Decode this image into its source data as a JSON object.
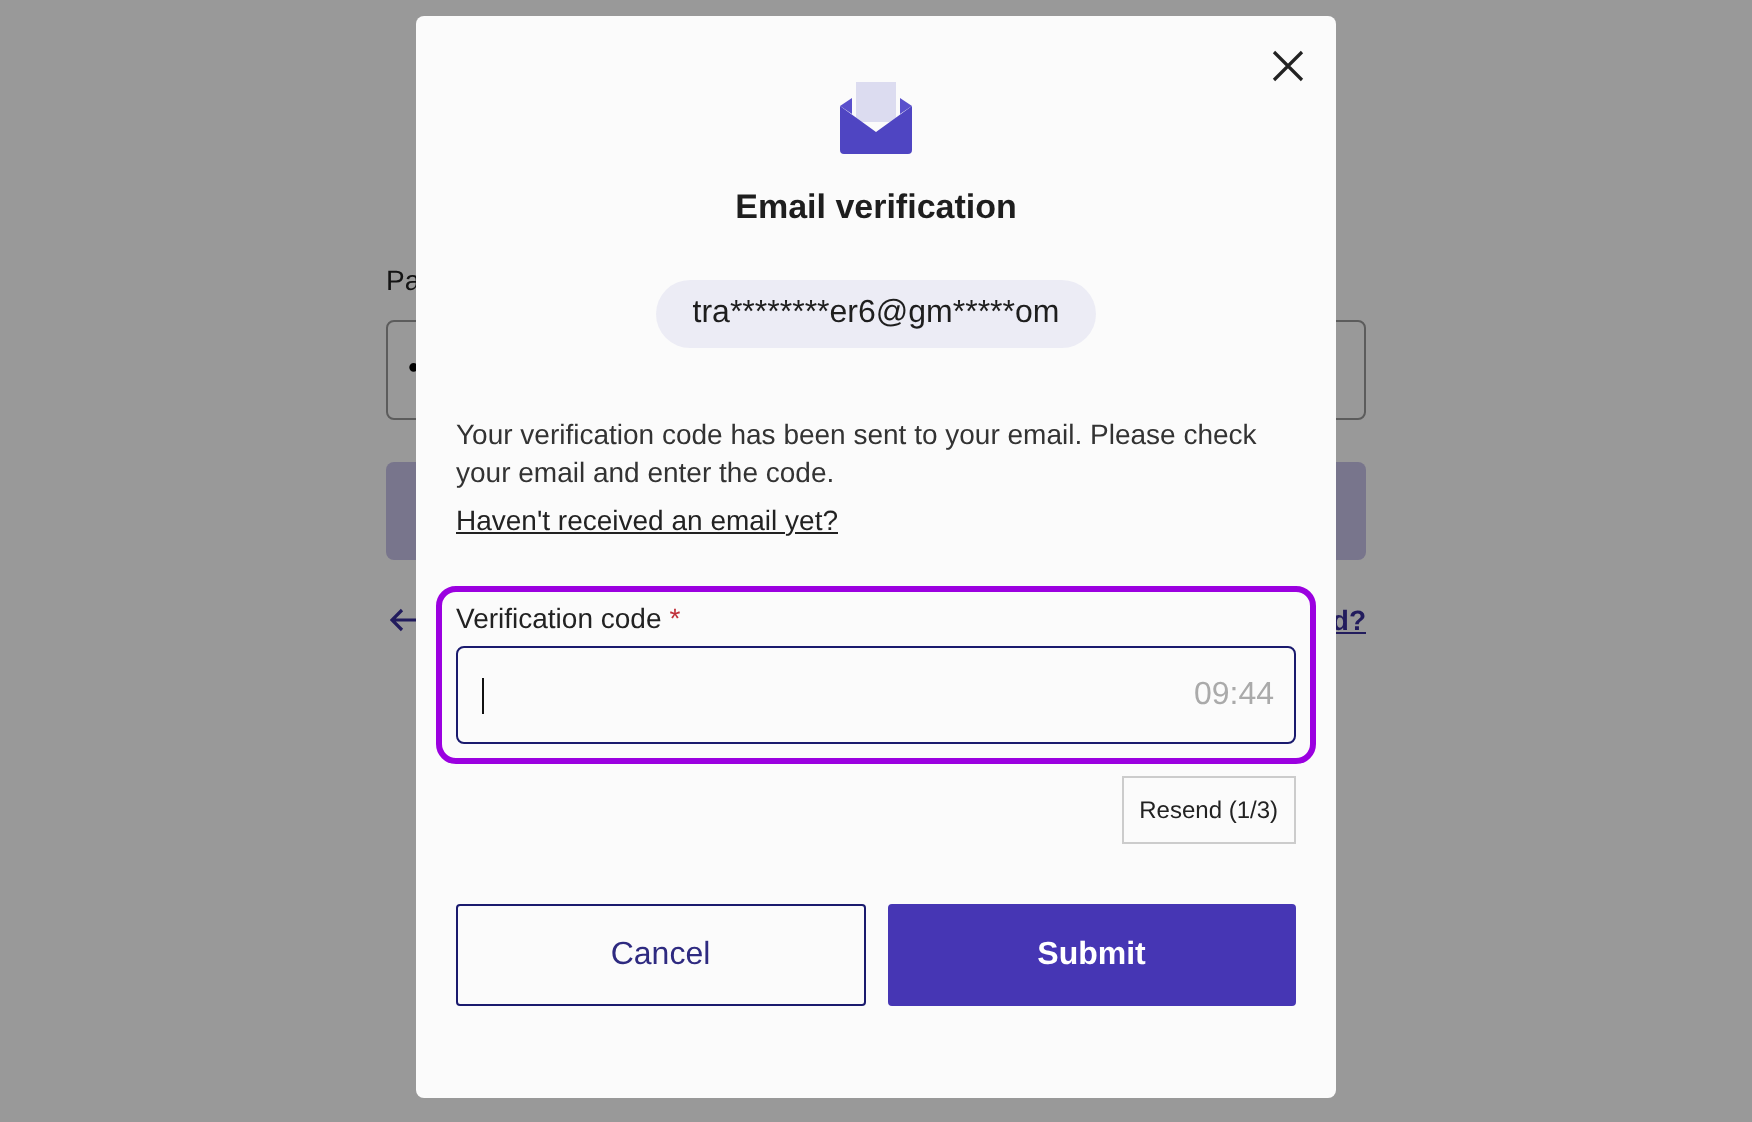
{
  "background_page": {
    "password_label": "Pa",
    "password_dot": "•",
    "link": "d?"
  },
  "dialog": {
    "title": "Email verification",
    "email": "tra********er6@gm*****om",
    "message": "Your verification code has been sent to your email. Please check your email and enter the code.",
    "help_link": "Haven't received an email yet?",
    "code_field": {
      "label": "Verification code",
      "required_mark": "*",
      "timer": "09:44",
      "highlighted": true
    },
    "resend_button": "Resend (1/3)",
    "buttons": [
      {
        "label": "Cancel",
        "kind": "secondary"
      },
      {
        "label": "Submit",
        "kind": "primary"
      }
    ]
  }
}
